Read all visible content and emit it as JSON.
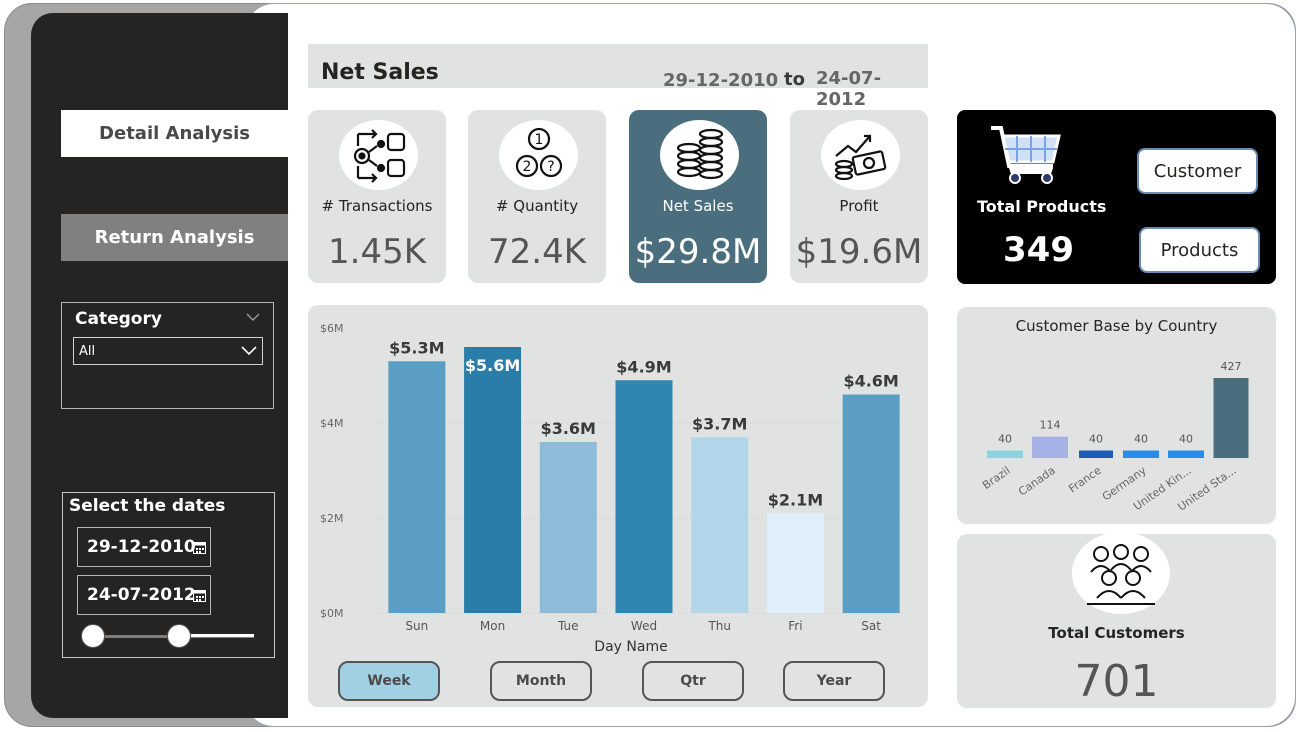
{
  "sidebar": {
    "nav": {
      "detail_label": "Detail Analysis",
      "return_label": "Return Analysis"
    },
    "category": {
      "title": "Category",
      "selected": "All"
    },
    "dates": {
      "title": "Select the dates",
      "from": "29-12-2010",
      "to": "24-07-2012"
    }
  },
  "header": {
    "title": "Net Sales",
    "date_from": "29-12-2010",
    "to_label": "to",
    "date_to": "24-07-2012"
  },
  "kpis": {
    "transactions": {
      "label": "# Transactions",
      "value": "1.45K",
      "icon": "transactions-icon"
    },
    "quantity": {
      "label": "# Quantity",
      "value": "72.4K",
      "icon": "quantity-icon"
    },
    "net_sales": {
      "label": "Net Sales",
      "value": "$29.8M",
      "icon": "coins-icon"
    },
    "profit": {
      "label": "Profit",
      "value": "$19.6M",
      "icon": "profit-icon"
    }
  },
  "products_card": {
    "label": "Total Products",
    "value": "349",
    "customer_button": "Customer",
    "products_button": "Products",
    "icon": "cart-icon"
  },
  "segments": {
    "week": "Week",
    "month": "Month",
    "qtr": "Qtr",
    "year": "Year",
    "active": "Week"
  },
  "customers_card": {
    "label": "Total Customers",
    "value": "701",
    "icon": "people-icon"
  },
  "colors": {
    "sidebar_bg": "#252423",
    "card_bg": "#e1e3e3",
    "accent": "#4b6e7e",
    "active_segment": "#a1d0e5"
  },
  "chart_data": [
    {
      "type": "bar",
      "categories": [
        "Sun",
        "Mon",
        "Tue",
        "Wed",
        "Thu",
        "Fri",
        "Sat"
      ],
      "values": [
        5.3,
        5.6,
        3.6,
        4.9,
        3.7,
        2.1,
        4.6
      ],
      "data_labels": [
        "$5.3M",
        "$5.6M",
        "$3.6M",
        "$4.9M",
        "$3.7M",
        "$2.1M",
        "$4.6M"
      ],
      "bar_colors": [
        "#5a9ec3",
        "#2a7da8",
        "#8cbcd9",
        "#2f86b1",
        "#b3d5ea",
        "#deeefb",
        "#5a9ec3"
      ],
      "xlabel": "Day Name",
      "ylabel": "",
      "ylim": [
        0,
        6
      ],
      "yticks": [
        "$0M",
        "$2M",
        "$4M",
        "$6M"
      ],
      "ytick_values": [
        0,
        2,
        4,
        6
      ],
      "grid": true
    },
    {
      "type": "bar",
      "title": "Customer Base by Country",
      "categories": [
        "Brazil",
        "Canada",
        "France",
        "Germany",
        "United Kin...",
        "United Sta..."
      ],
      "values": [
        40,
        114,
        40,
        40,
        40,
        427
      ],
      "bar_colors": [
        "#8dd3df",
        "#a6b2e6",
        "#1a5cb8",
        "#2a8be8",
        "#2a8be8",
        "#4b6e7e"
      ],
      "ylim": [
        0,
        427
      ],
      "grid": false
    }
  ]
}
